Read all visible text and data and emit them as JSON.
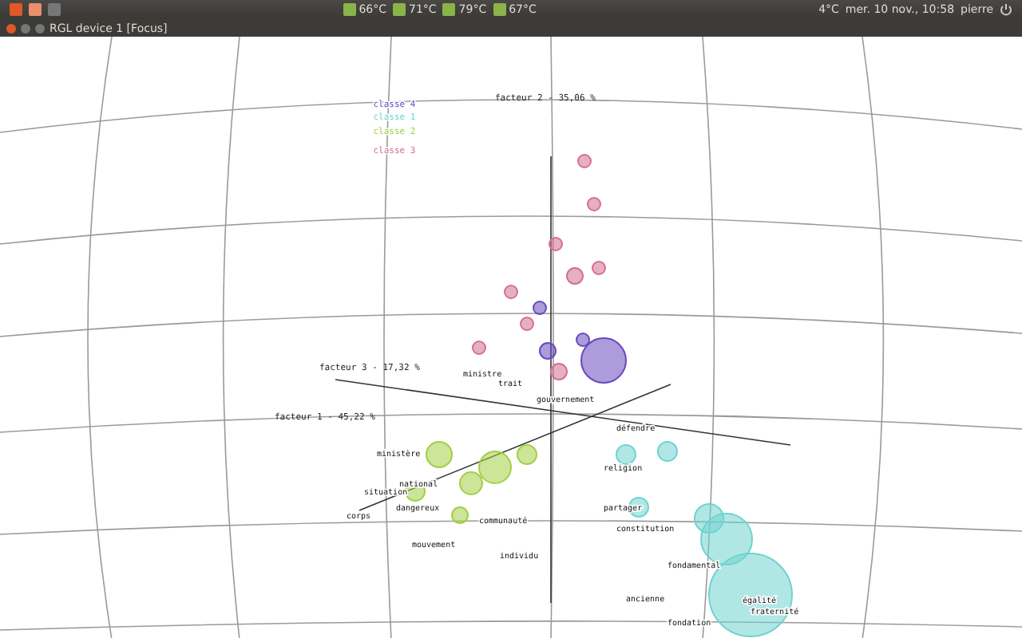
{
  "top_panel": {
    "temperatures": [
      "66°C",
      "71°C",
      "79°C",
      "67°C"
    ],
    "weather": "4°C",
    "clock": "mer. 10 nov., 10:58",
    "user": "pierre"
  },
  "window": {
    "title": "RGL device 1 [Focus]"
  },
  "plot": {
    "axis_labels": [
      "facteur 2 - 35,06 %",
      "facteur 3 - 17,32 %",
      "facteur 1 - 45,22 %"
    ],
    "legend": [
      {
        "label": "classe 4",
        "color": "#6a48c0"
      },
      {
        "label": "classe 1",
        "color": "#6fd3cf"
      },
      {
        "label": "classe 2",
        "color": "#a2cf45"
      },
      {
        "label": "classe 3",
        "color": "#d4708e",
        "words": [
          "ministre",
          "trait",
          "gouvernement"
        ]
      }
    ],
    "words_1": [
      "défendre",
      "religion",
      "partager",
      "constitution",
      "fondamental",
      "ancienne",
      "égalité",
      "fraternité",
      "fondation"
    ],
    "words_2": [
      "ministère",
      "national",
      "situation",
      "dangereux",
      "corps",
      "communauté",
      "mouvement",
      "individu"
    ]
  }
}
